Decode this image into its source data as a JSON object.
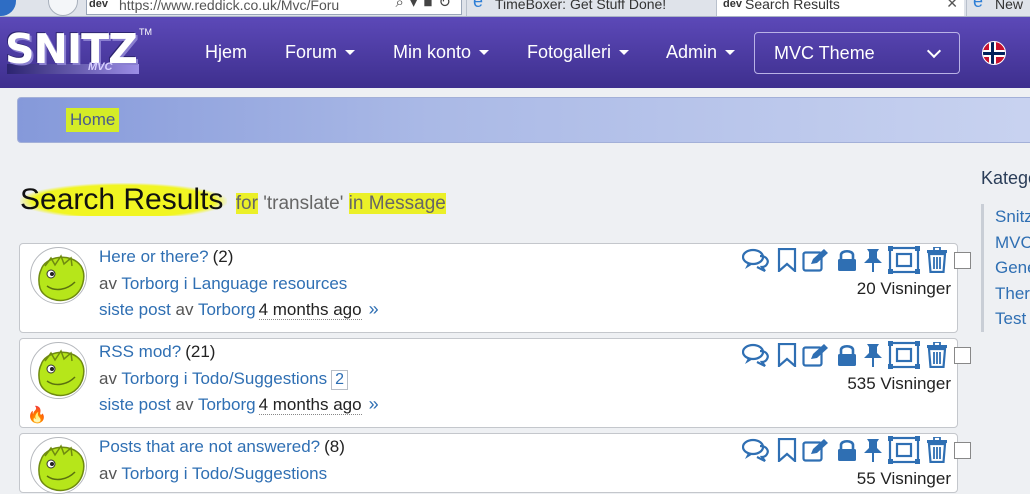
{
  "browser": {
    "address": "https://www.reddick.co.uk/Mvc/Foru",
    "favicon_text": "dev",
    "tabs": [
      {
        "label": "TimeBoxer: Get Stuff Done!"
      },
      {
        "label": "Search Results",
        "active": true
      },
      {
        "label": "New"
      }
    ]
  },
  "navbar": {
    "logo": {
      "text": "SNITZ",
      "sub": "MVC",
      "tm": "TM"
    },
    "items": [
      "Hjem",
      "Forum",
      "Min konto",
      "Fotogalleri",
      "Admin"
    ],
    "theme_select": "MVC Theme",
    "language": "Norwegian"
  },
  "breadcrumb": {
    "home": "Home"
  },
  "search": {
    "title": "Search Results",
    "for_word": "for",
    "term": "'translate'",
    "in_word": "in",
    "scope": "Message"
  },
  "topics": [
    {
      "title": "Here or there?",
      "count": "(2)",
      "by": "av",
      "author": "Torborg",
      "in": "i",
      "forum": "Language resources",
      "last_label": "siste post",
      "last_by": "av",
      "last_author": "Torborg",
      "time": "4 months ago",
      "raquo": "»",
      "views": "20 Visninger",
      "hot": false
    },
    {
      "title": "RSS mod?",
      "count": "(21)",
      "by": "av",
      "author": "Torborg",
      "in": "i",
      "forum": "Todo/Suggestions",
      "pages": "2",
      "last_label": "siste post",
      "last_by": "av",
      "last_author": "Torborg",
      "time": "4 months ago",
      "raquo": "»",
      "views": "535 Visninger",
      "hot": true
    },
    {
      "title": "Posts that are not answered?",
      "count": "(8)",
      "by": "av",
      "author": "Torborg",
      "in": "i",
      "forum": "Todo/Suggestions",
      "views": "55 Visninger",
      "hot": false
    }
  ],
  "sidebar": {
    "heading": "Katego",
    "items": [
      "Snitz",
      "MVC",
      "Gene",
      "Ther",
      "Test"
    ]
  },
  "colors": {
    "navbar": "#4a3aa3",
    "link": "#2f6fb3",
    "highlight": "#ebf028",
    "action_icons": "#2f6fb3"
  }
}
